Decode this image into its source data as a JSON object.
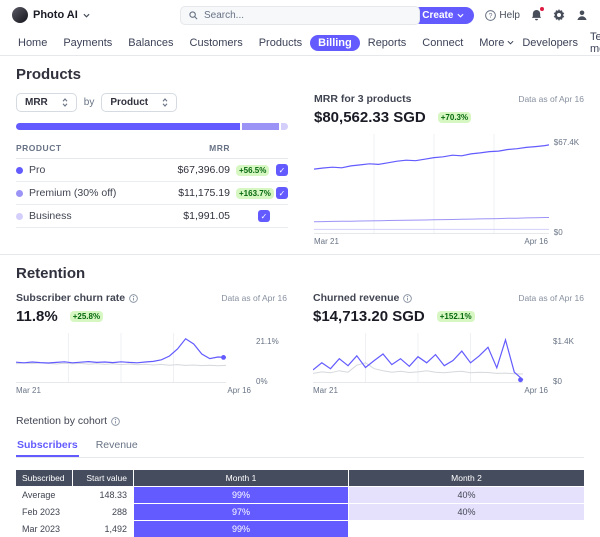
{
  "topbar": {
    "workspace": "Photo AI",
    "search_placeholder": "Search...",
    "create_label": "Create",
    "help_label": "Help"
  },
  "nav": {
    "items": [
      {
        "label": "Home"
      },
      {
        "label": "Payments"
      },
      {
        "label": "Balances"
      },
      {
        "label": "Customers"
      },
      {
        "label": "Products"
      },
      {
        "label": "Billing"
      },
      {
        "label": "Reports"
      },
      {
        "label": "Connect"
      },
      {
        "label": "More"
      }
    ],
    "developers": "Developers",
    "test_mode": "Test mode"
  },
  "products": {
    "heading": "Products",
    "metric_select": "MRR",
    "by": "by",
    "dimension_select": "Product",
    "bar_segments": [
      {
        "color": "#635bff",
        "pct": 83.5
      },
      {
        "color": "#9c93f6",
        "pct": 13.9
      },
      {
        "color": "#d3cffa",
        "pct": 2.6
      }
    ],
    "table": {
      "col_product": "PRODUCT",
      "col_mrr": "MRR",
      "rows": [
        {
          "name": "Pro",
          "value": "$67,396.09",
          "delta": "+56.5%",
          "dot": "#635bff"
        },
        {
          "name": "Premium (30% off)",
          "value": "$11,175.19",
          "delta": "+163.7%",
          "dot": "#9c93f6"
        },
        {
          "name": "Business",
          "value": "$1,991.05",
          "delta": "",
          "dot": "#d3cffa"
        }
      ]
    }
  },
  "mrr_chart": {
    "title": "MRR for 3 products",
    "data_as_of": "Data as of Apr 16",
    "value": "$80,562.33 SGD",
    "delta": "+70.3%",
    "y_top": "$67.4K",
    "y_bottom": "$0",
    "x_start": "Mar 21",
    "x_end": "Apr 16"
  },
  "retention": {
    "heading": "Retention",
    "churn": {
      "title": "Subscriber churn rate",
      "data_as_of": "Data as of Apr 16",
      "value": "11.8%",
      "delta": "+25.8%",
      "y_top": "21.1%",
      "y_bottom": "0%",
      "x_start": "Mar 21",
      "x_end": "Apr 16"
    },
    "churned": {
      "title": "Churned revenue",
      "data_as_of": "Data as of Apr 16",
      "value": "$14,713.20 SGD",
      "delta": "+152.1%",
      "y_top": "$1.4K",
      "y_bottom": "$0",
      "x_start": "Mar 21",
      "x_end": "Apr 16"
    },
    "cohort": {
      "title": "Retention by cohort",
      "tabs": [
        {
          "label": "Subscribers"
        },
        {
          "label": "Revenue"
        }
      ],
      "headers": {
        "subscribed": "Subscribed",
        "start_value": "Start value",
        "month1": "Month 1",
        "month2": "Month 2"
      },
      "rows": [
        {
          "cohort": "Average",
          "start": "148.33",
          "m1": "99%",
          "m2": "40%"
        },
        {
          "cohort": "Feb 2023",
          "start": "288",
          "m1": "97%",
          "m2": "40%"
        },
        {
          "cohort": "Mar 2023",
          "start": "1,492",
          "m1": "99%",
          "m2": ""
        }
      ]
    }
  },
  "charts": {
    "mrr": {
      "type": "line",
      "ymax": 72,
      "series": [
        {
          "name": "Pro",
          "color": "#635bff",
          "width": 1.2,
          "end_dot": true,
          "values": [
            48.2,
            49,
            49.6,
            49.2,
            50.6,
            51.4,
            52.2,
            51.8,
            53,
            54.2,
            55,
            54.6,
            55.8,
            57,
            57.6,
            58.8,
            58.4,
            59.8,
            60.6,
            61.6,
            62,
            63.2,
            63.8,
            64.8,
            65.4,
            66.2,
            67.4
          ]
        },
        {
          "name": "Premium (30% off)",
          "color": "#9c93f6",
          "width": 1,
          "values": [
            7.9,
            8,
            8.1,
            8.2,
            8.2,
            8.4,
            8.5,
            8.6,
            8.8,
            8.9,
            9,
            9.1,
            9.2,
            9.4,
            9.5,
            9.6,
            9.8,
            9.9,
            10,
            10.2,
            10.3,
            10.5,
            10.6,
            10.8,
            10.9,
            11.1,
            11.2
          ]
        },
        {
          "name": "Business",
          "color": "#d3cffa",
          "width": 1,
          "values": [
            2,
            2,
            2,
            2,
            2,
            2,
            2,
            2,
            2,
            2,
            2,
            2,
            2,
            2,
            2,
            2,
            2,
            2,
            2,
            2,
            2,
            2,
            2,
            2,
            2,
            2,
            2
          ]
        }
      ]
    },
    "churn": {
      "type": "line",
      "ymax": 22,
      "series": [
        {
          "name": "Previous period",
          "color": "#d5d8dc",
          "width": 1,
          "values": [
            8.6,
            9,
            8.7,
            9.1,
            8.8,
            8.5,
            8.9,
            8.6,
            8.8,
            8.4,
            8.7,
            8.3,
            8.6,
            8.2,
            8.5,
            8.1,
            8.4,
            8,
            8.3,
            7.9,
            8.2,
            7.8,
            8,
            7.7,
            7.9,
            7.6,
            7.8
          ]
        },
        {
          "name": "Subscriber churn rate",
          "color": "#635bff",
          "width": 1.2,
          "end_dot": true,
          "values": [
            9.4,
            9.1,
            9.5,
            9.2,
            9,
            9.3,
            9.6,
            9.1,
            9.4,
            9.7,
            9.3,
            9.5,
            9.2,
            9.6,
            9.3,
            9.1,
            9.5,
            9.8,
            10.6,
            12.5,
            16,
            21.1,
            18.5,
            13.5,
            11.2,
            12,
            11.8
          ]
        }
      ]
    },
    "churned": {
      "type": "line",
      "ymax": 1500,
      "series": [
        {
          "name": "Previous period",
          "color": "#d5d8dc",
          "width": 1,
          "values": [
            260,
            310,
            280,
            350,
            300,
            540,
            620,
            420,
            350,
            300,
            330,
            290,
            310,
            350,
            300,
            280,
            310,
            330,
            280,
            300,
            290,
            260,
            270,
            250,
            240
          ]
        },
        {
          "name": "Churned revenue",
          "color": "#635bff",
          "width": 1.2,
          "end_dot": true,
          "values": [
            380,
            620,
            420,
            760,
            520,
            860,
            460,
            700,
            920,
            560,
            760,
            500,
            830,
            620,
            900,
            520,
            700,
            1020,
            620,
            860,
            1150,
            450,
            1400,
            300,
            40
          ]
        }
      ]
    }
  }
}
